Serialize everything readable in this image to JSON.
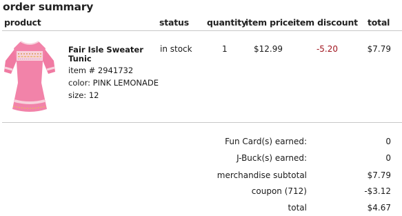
{
  "order_summary": {
    "title": "order summary",
    "columns": {
      "product": "product",
      "status": "status",
      "quantity": "quantity",
      "item_price": "item price",
      "item_discount": "item discount",
      "total": "total"
    },
    "items": [
      {
        "name": "Fair Isle Sweater Tunic",
        "item_number": "item # 2941732",
        "color": "color: PINK LEMONADE",
        "size": "size: 12",
        "status": "in stock",
        "quantity": "1",
        "item_price": "$12.99",
        "item_discount": "-5.20",
        "total": "$7.79",
        "image_icon": "pink-fair-isle-tunic-image"
      }
    ],
    "summary": {
      "fun_card_label": "Fun Card(s) earned:",
      "fun_card_value": "0",
      "jbuck_label": "J-Buck(s) earned:",
      "jbuck_value": "0",
      "subtotal_label": "merchandise subtotal",
      "subtotal_value": "$7.79",
      "coupon_label": "coupon (712)",
      "coupon_value": "-$3.12",
      "total_label": "total",
      "total_value": "$4.67"
    },
    "colors": {
      "discount": "#a0141e",
      "rule": "#c7c7c7",
      "product_pink": "#f080a8"
    }
  }
}
